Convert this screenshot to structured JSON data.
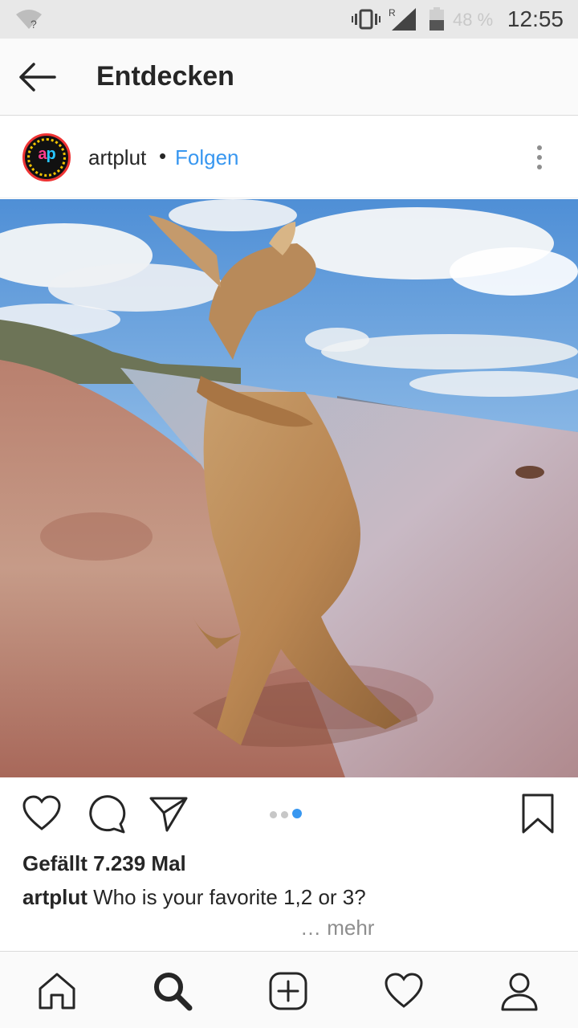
{
  "status_bar": {
    "battery_percent": "48 %",
    "time": "12:55",
    "wifi_icon": "wifi-unknown-icon",
    "vibrate_icon": "vibrate-icon",
    "signal_icon": "signal-roaming-icon",
    "signal_badge": "R",
    "battery_icon": "battery-icon"
  },
  "app_bar": {
    "back_icon": "arrow-left-icon",
    "title": "Entdecken"
  },
  "post": {
    "username": "artplut",
    "separator": "•",
    "follow_label": "Folgen",
    "more_icon": "more-vertical-icon",
    "avatar_text_a": "a",
    "avatar_text_p": "p",
    "image_alt": "kangaroo on beach photo",
    "carousel": {
      "count": 3,
      "active_index": 2
    },
    "likes_text": "Gefällt 7.239 Mal",
    "caption_user": "artplut",
    "caption_text": " Who is your favorite 1,2 or 3?",
    "more_label": "… mehr"
  },
  "actions": {
    "like_icon": "heart-icon",
    "comment_icon": "comment-icon",
    "share_icon": "paper-plane-icon",
    "save_icon": "bookmark-icon"
  },
  "bottom_nav": [
    {
      "name": "home",
      "icon": "home-icon"
    },
    {
      "name": "search",
      "icon": "search-icon",
      "active": true
    },
    {
      "name": "add",
      "icon": "add-post-icon"
    },
    {
      "name": "activity",
      "icon": "heart-icon"
    },
    {
      "name": "profile",
      "icon": "profile-icon"
    }
  ],
  "colors": {
    "link_blue": "#3897f0",
    "text_dark": "#262626",
    "muted": "#8e8e8e",
    "status_bar_bg": "#e8e8e8"
  }
}
